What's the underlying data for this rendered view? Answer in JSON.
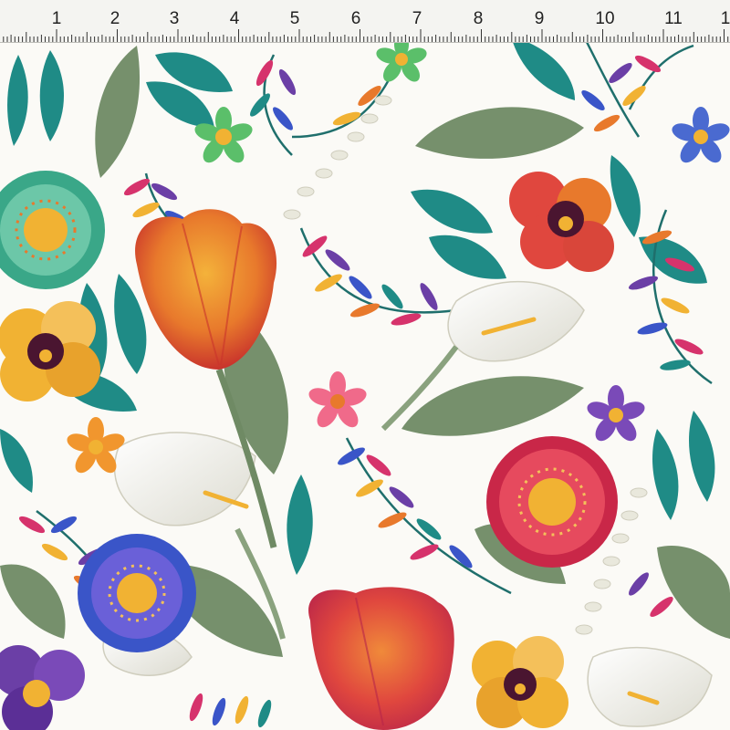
{
  "ruler": {
    "marks": [
      "1",
      "2",
      "3",
      "4",
      "5",
      "6",
      "7",
      "8",
      "9",
      "10",
      "11",
      "1"
    ]
  },
  "fabric": {
    "background_color": "#fbfaf6",
    "palette": {
      "tulip_orange": "#e8792c",
      "tulip_red": "#d9463a",
      "pansy_yellow": "#f1b233",
      "pansy_purple": "#4a1530",
      "teal_leaf": "#1f8b86",
      "sage_leaf": "#6f8a64",
      "calla_white": "#f2f1ea",
      "violet": "#6b3fa6",
      "magenta": "#d6336c",
      "blue": "#3a55c8"
    },
    "motifs": [
      "tulip-icon",
      "calla-lily-icon",
      "pansy-icon",
      "daisy-icon",
      "fern-sprig-icon",
      "leaf-icon",
      "star-flower-icon"
    ]
  }
}
